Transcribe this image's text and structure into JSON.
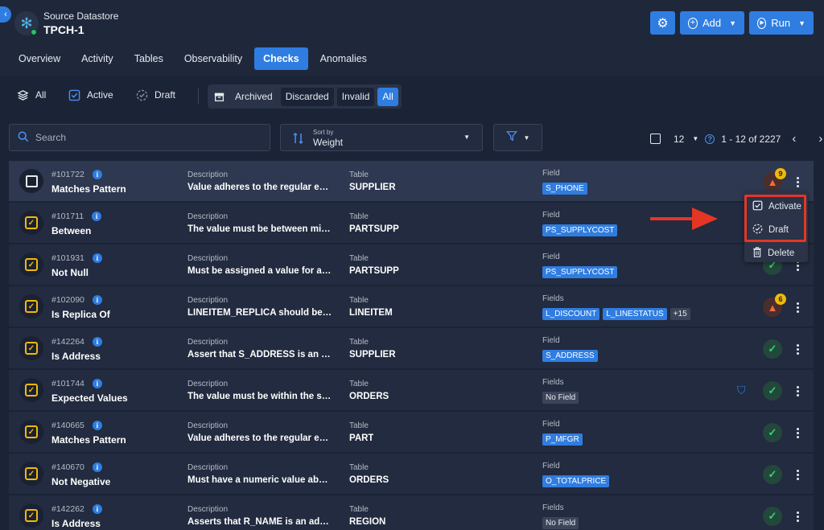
{
  "header": {
    "subtitle": "Source Datastore",
    "title": "TPCH-1",
    "add_label": "Add",
    "run_label": "Run",
    "accent": "#2f7de1"
  },
  "tabs": [
    {
      "label": "Overview"
    },
    {
      "label": "Activity"
    },
    {
      "label": "Tables"
    },
    {
      "label": "Observability"
    },
    {
      "label": "Checks",
      "active": true
    },
    {
      "label": "Anomalies"
    }
  ],
  "status_filters": {
    "all": "All",
    "active": "Active",
    "draft": "Draft"
  },
  "segmented": [
    "Archived",
    "Discarded",
    "Invalid",
    "All"
  ],
  "search": {
    "placeholder": "Search"
  },
  "sort": {
    "caption": "Sort by",
    "value": "Weight"
  },
  "pager": {
    "per_page": "12",
    "range": "1 - 12 of 2227"
  },
  "rows": [
    {
      "id": "#101722",
      "name": "Matches Pattern",
      "desc_label": "Description",
      "desc": "Value adheres to the regular expr...",
      "table_label": "Table",
      "table": "SUPPLIER",
      "field_label": "Field",
      "fields": [
        "S_PHONE"
      ],
      "status": "warn",
      "count": "9"
    },
    {
      "id": "#101711",
      "name": "Between",
      "desc_label": "Description",
      "desc": "The value must be between min a...",
      "table_label": "Table",
      "table": "PARTSUPP",
      "field_label": "Field",
      "fields": [
        "PS_SUPPLYCOST"
      ],
      "status": "ok"
    },
    {
      "id": "#101931",
      "name": "Not Null",
      "desc_label": "Description",
      "desc": "Must be assigned a value for at le...",
      "table_label": "Table",
      "table": "PARTSUPP",
      "field_label": "Field",
      "fields": [
        "PS_SUPPLYCOST"
      ],
      "status": "ok"
    },
    {
      "id": "#102090",
      "name": "Is Replica Of",
      "desc_label": "Description",
      "desc": "LINEITEM_REPLICA should be a re...",
      "table_label": "Table",
      "table": "LINEITEM",
      "field_label": "Fields",
      "fields": [
        "L_DISCOUNT",
        "L_LINESTATUS"
      ],
      "more": "+15",
      "status": "warn",
      "count": "6"
    },
    {
      "id": "#142264",
      "name": "Is Address",
      "desc_label": "Description",
      "desc": "Assert that S_ADDRESS is an add...",
      "table_label": "Table",
      "table": "SUPPLIER",
      "field_label": "Field",
      "fields": [
        "S_ADDRESS"
      ],
      "status": "ok"
    },
    {
      "id": "#101744",
      "name": "Expected Values",
      "desc_label": "Description",
      "desc": "The value must be within the spec...",
      "table_label": "Table",
      "table": "ORDERS",
      "field_label": "Fields",
      "nofield": "No Field",
      "status": "ok",
      "filter": true
    },
    {
      "id": "#140665",
      "name": "Matches Pattern",
      "desc_label": "Description",
      "desc": "Value adheres to the regular expr...",
      "table_label": "Table",
      "table": "PART",
      "field_label": "Field",
      "fields": [
        "P_MFGR"
      ],
      "status": "ok"
    },
    {
      "id": "#140670",
      "name": "Not Negative",
      "desc_label": "Description",
      "desc": "Must have a numeric value above ...",
      "table_label": "Table",
      "table": "ORDERS",
      "field_label": "Field",
      "fields": [
        "O_TOTALPRICE"
      ],
      "status": "ok"
    },
    {
      "id": "#142262",
      "name": "Is Address",
      "desc_label": "Description",
      "desc": "Asserts that R_NAME is an address",
      "table_label": "Table",
      "table": "REGION",
      "field_label": "Fields",
      "nofield": "No Field",
      "status": "ok"
    }
  ],
  "menu": {
    "activate": "Activate",
    "draft": "Draft",
    "delete": "Delete"
  }
}
